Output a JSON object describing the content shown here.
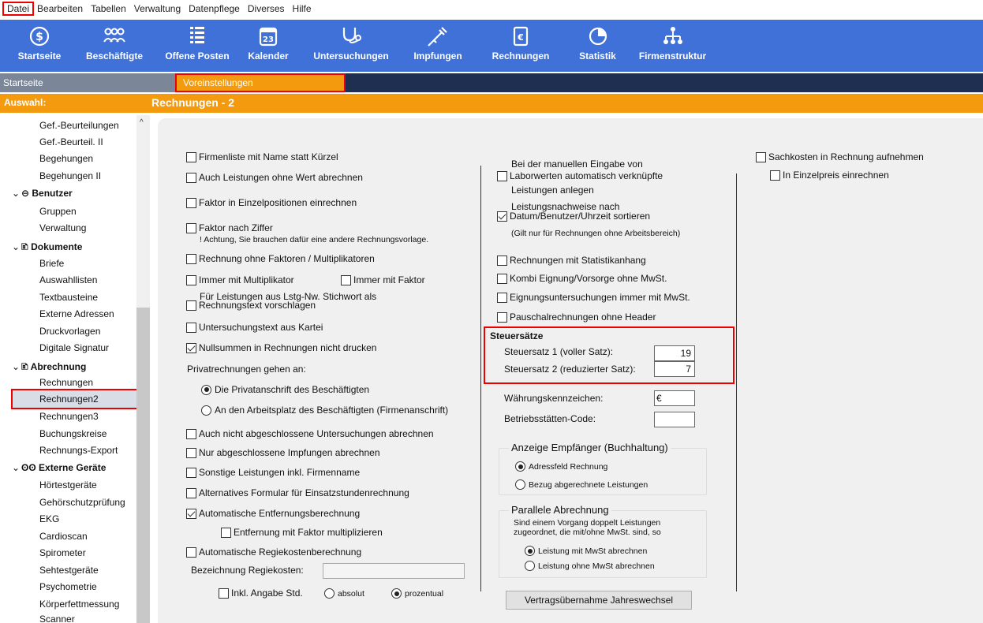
{
  "menu": [
    "Datei",
    "Bearbeiten",
    "Tabellen",
    "Verwaltung",
    "Datenpflege",
    "Diverses",
    "Hilfe"
  ],
  "toolbar": {
    "startseite": "Startseite",
    "beschaeftigte": "Beschäftigte",
    "offene_posten": "Offene Posten",
    "kalender": "Kalender",
    "kalender_day": "23",
    "untersuchungen": "Untersuchungen",
    "impfungen": "Impfungen",
    "rechnungen": "Rechnungen",
    "statistik": "Statistik",
    "firmenstruktur": "Firmenstruktur"
  },
  "tabs": {
    "start": "Startseite",
    "voreinstellungen": "Voreinstellungen"
  },
  "selection": {
    "label": "Auswahl:",
    "title": "Rechnungen - 2"
  },
  "sidebar": {
    "i1": "Gef.-Beurteilungen",
    "i2": "Gef.-Beurteil. II",
    "i3": "Begehungen",
    "i4": "Begehungen II",
    "g_benutzer": "Benutzer",
    "i5": "Gruppen",
    "i6": "Verwaltung",
    "g_dokumente": "Dokumente",
    "i7": "Briefe",
    "i8": "Auswahllisten",
    "i9": "Textbausteine",
    "i10": "Externe Adressen",
    "i11": "Druckvorlagen",
    "i12": "Digitale Signatur",
    "g_abrechnung": "Abrechnung",
    "i13": "Rechnungen",
    "i14": "Rechnungen2",
    "i15": "Rechnungen3",
    "i16": "Buchungskreise",
    "i17": "Rechnungs-Export",
    "g_geraete": "Externe Geräte",
    "i18": "Hörtestgeräte",
    "i19": "Gehörschutzprüfung",
    "i20": "EKG",
    "i21": "Cardioscan",
    "i22": "Spirometer",
    "i23": "Sehtestgeräte",
    "i24": "Psychometrie",
    "i25": "Körperfettmessung",
    "i26": "Scanner"
  },
  "col1": {
    "c1": "Firmenliste mit Name statt Kürzel",
    "c2": "Auch Leistungen ohne Wert abrechnen",
    "c3": "Faktor in Einzelpositionen einrechnen",
    "c4": "Faktor nach Ziffer",
    "c4_note": "! Achtung, Sie brauchen dafür eine andere Rechnungsvorlage.",
    "c5": "Rechnung ohne Faktoren / Multiplikatoren",
    "c6": "Immer mit Multiplikator",
    "c6b": "Immer mit Faktor",
    "c7_l1": "Für Leistungen aus Lstg-Nw. Stichwort als",
    "c7_l2": "Rechnungstext vorschlagen",
    "c8": "Untersuchungstext aus Kartei",
    "c9": "Nullsummen in Rechnungen nicht drucken",
    "priv_label": "Privatrechnungen gehen an:",
    "r1": "Die Privatanschrift des Beschäftigten",
    "r2": "An den Arbeitsplatz des Beschäftigten (Firmenanschrift)",
    "c10": "Auch nicht abgeschlossene Untersuchungen abrechnen",
    "c11": "Nur abgeschlossene Impfungen abrechnen",
    "c12": "Sonstige Leistungen inkl. Firmenname",
    "c13": "Alternatives Formular für Einsatzstundenrechnung",
    "c14": "Automatische Entfernungsberechnung",
    "c15": "Entfernung mit Faktor multiplizieren",
    "c16": "Automatische Regiekostenberechnung",
    "regie_label": "Bezeichnung Regiekosten:",
    "regie_value": "",
    "c17": "Inkl. Angabe Std.",
    "r3": "absolut",
    "r4": "prozentual"
  },
  "col2": {
    "c1_l1": "Bei der manuellen Eingabe von",
    "c1_l2": "Laborwerten automatisch verknüpfte",
    "c1_l3": "Leistungen anlegen",
    "c2_l1": "Leistungsnachweise nach",
    "c2_l2": "Datum/Benutzer/Uhrzeit sortieren",
    "c2_note": "(Gilt nur für Rechnungen ohne Arbeitsbereich)",
    "c3": "Rechnungen mit Statistikanhang",
    "c4": "Kombi Eignung/Vorsorge ohne MwSt.",
    "c5": "Eignungsuntersuchungen immer mit MwSt.",
    "c6": "Pauschalrechnungen ohne Header",
    "steuer_title": "Steuersätze",
    "steuer1_label": "Steuersatz 1 (voller Satz):",
    "steuer1_value": "19",
    "steuer2_label": "Steuersatz 2 (reduzierter Satz):",
    "steuer2_value": "7",
    "waehrung_label": "Währungskennzeichen:",
    "waehrung_value": "€",
    "bst_label": "Betriebsstätten-Code:",
    "bst_value": "",
    "anzeige_title": "Anzeige Empfänger (Buchhaltung)",
    "a1": "Adressfeld Rechnung",
    "a2": "Bezug abgerechnete Leistungen",
    "parallel_title": "Parallele Abrechnung",
    "parallel_l1": "Sind einem Vorgang doppelt Leistungen",
    "parallel_l2": "zugeordnet, die mit/ohne MwSt. sind, so",
    "p1": "Leistung mit MwSt abrechnen",
    "p2": "Leistung ohne MwSt abrechnen",
    "button": "Vertragsübernahme Jahreswechsel"
  },
  "col3": {
    "c1": "Sachkosten in Rechnung aufnehmen",
    "c2": "In Einzelpreis einrechnen"
  }
}
